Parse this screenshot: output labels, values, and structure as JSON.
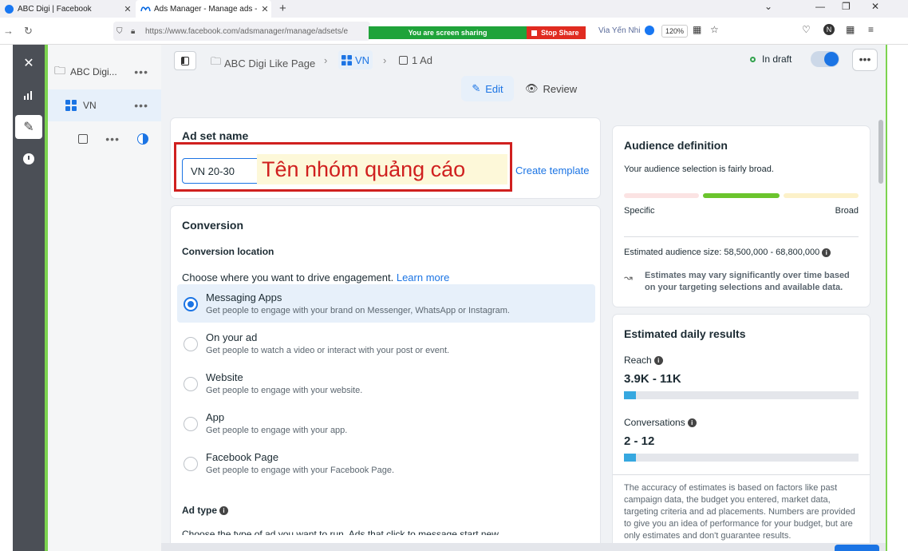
{
  "browser": {
    "tabs": [
      {
        "title": "ABC Digi | Facebook",
        "active": false
      },
      {
        "title": "Ads Manager - Manage ads - A",
        "active": true
      }
    ],
    "url": "https://www.facebook.com/adsmanager/manage/adsets/e",
    "screen_share": "You are screen sharing",
    "stop_share": "Stop Share",
    "profile_text": "Via Yến Nhi",
    "zoom": "120%"
  },
  "tree": {
    "items": [
      {
        "label": "ABC Digi...",
        "icon": "folder-icon"
      },
      {
        "label": "VN",
        "icon": "grid-icon"
      },
      {
        "label": "",
        "icon": "ad-icon"
      }
    ]
  },
  "breadcrumb": {
    "campaign": "ABC Digi Like Page",
    "adset": "VN",
    "ads": "1 Ad"
  },
  "status": {
    "label": "In draft",
    "status_color": "#31a24c"
  },
  "mode": {
    "edit": "Edit",
    "review": "Review"
  },
  "adset_name": {
    "label": "Ad set name",
    "value": "VN 20-30",
    "create_template": "Create template",
    "annotation": "Tên nhóm quảng cáo"
  },
  "conversion": {
    "heading": "Conversion",
    "location_label": "Conversion location",
    "prompt": "Choose where you want to drive engagement.",
    "learn_more": "Learn more",
    "options": [
      {
        "title": "Messaging Apps",
        "desc": "Get people to engage with your brand on Messenger, WhatsApp or Instagram.",
        "selected": true
      },
      {
        "title": "On your ad",
        "desc": "Get people to watch a video or interact with your post or event.",
        "selected": false
      },
      {
        "title": "Website",
        "desc": "Get people to engage with your website.",
        "selected": false
      },
      {
        "title": "App",
        "desc": "Get people to engage with your app.",
        "selected": false
      },
      {
        "title": "Facebook Page",
        "desc": "Get people to engage with your Facebook Page.",
        "selected": false
      }
    ],
    "ad_type_label": "Ad type",
    "ad_type_desc": "Choose the type of ad you want to run. Ads that click to message start new"
  },
  "audience": {
    "heading": "Audience definition",
    "summary": "Your audience selection is fairly broad.",
    "specific": "Specific",
    "broad": "Broad",
    "size_text": "Estimated audience size: 58,500,000 - 68,800,000",
    "note": "Estimates may vary significantly over time based on your targeting selections and available data."
  },
  "daily_results": {
    "heading": "Estimated daily results",
    "reach_label": "Reach",
    "reach_value": "3.9K - 11K",
    "reach_fill": 0.05,
    "conv_label": "Conversations",
    "conv_value": "2 - 12",
    "conv_fill": 0.05,
    "disclaimer": "The accuracy of estimates is based on factors like past campaign data, the budget you entered, market data, targeting criteria and ad placements. Numbers are provided to give you an idea of performance for your budget, but are only estimates and don't guarantee results."
  },
  "colors": {
    "accent": "#1b74e4",
    "annotation_red": "#d0201f",
    "audience_green": "#6bc42d"
  }
}
